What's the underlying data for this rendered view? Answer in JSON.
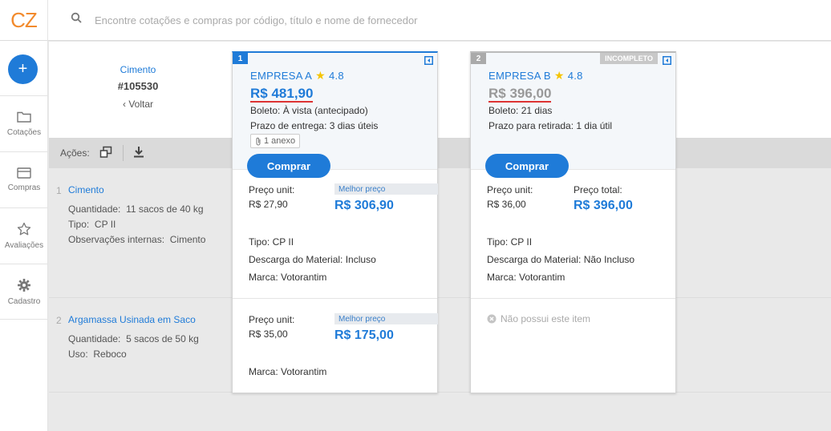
{
  "app": {
    "logo": "CZ"
  },
  "search": {
    "placeholder": "Encontre cotações e compras por código, título e nome de fornecedor"
  },
  "sidebar": {
    "add_label": "+",
    "items": [
      {
        "label": "Cotações",
        "icon": "folder-icon"
      },
      {
        "label": "Compras",
        "icon": "credit-card-icon"
      },
      {
        "label": "Avaliações",
        "icon": "star-icon"
      },
      {
        "label": "Cadastro",
        "icon": "gear-icon"
      }
    ]
  },
  "quote": {
    "title": "Cimento",
    "id": "#105530",
    "back": "‹ Voltar"
  },
  "actions": {
    "label": "Ações:"
  },
  "items": [
    {
      "num": "1",
      "name": "Cimento",
      "details": [
        {
          "label": "Quantidade:",
          "value": "11 sacos de 40 kg"
        },
        {
          "label": "Tipo:",
          "value": "CP II"
        },
        {
          "label": "Observações internas:",
          "value": "Cimento"
        }
      ]
    },
    {
      "num": "2",
      "name": "Argamassa Usinada em Saco",
      "details": [
        {
          "label": "Quantidade:",
          "value": "5 sacos de 50 kg"
        },
        {
          "label": "Uso:",
          "value": "Reboco"
        }
      ]
    }
  ],
  "suppliers": [
    {
      "rank": "1",
      "name": "EMPRESA A",
      "rating": "4.8",
      "total": "R$ 481,90",
      "payment": "Boleto: À vista (antecipado)",
      "delivery": "Prazo de entrega:  3 dias úteis",
      "attachments": "1 anexo",
      "buy_label": "Comprar",
      "item1": {
        "unit_label": "Preço unit:",
        "unit_price": "R$ 27,90",
        "best_label": "Melhor preço",
        "total_price": "R$ 306,90",
        "tipo": "Tipo:  CP II",
        "descarga": "Descarga do Material:  Incluso",
        "marca": "Marca:  Votorantim"
      },
      "item2": {
        "unit_label": "Preço unit:",
        "unit_price": "R$ 35,00",
        "best_label": "Melhor preço",
        "total_price": "R$ 175,00",
        "marca": "Marca:  Votorantim"
      }
    },
    {
      "rank": "2",
      "badge": "INCOMPLETO",
      "name": "EMPRESA B",
      "rating": "4.8",
      "total": "R$ 396,00",
      "payment": "Boleto: 21 dias",
      "delivery": "Prazo para retirada:  1 dia útil",
      "buy_label": "Comprar",
      "item1": {
        "unit_label": "Preço unit:",
        "unit_price": "R$ 36,00",
        "total_label": "Preço total:",
        "total_price": "R$ 396,00",
        "tipo": "Tipo:  CP II",
        "descarga": "Descarga do Material:  Não Incluso",
        "marca": "Marca:  Votorantim"
      },
      "item2_missing": "Não possui este item"
    }
  ]
}
